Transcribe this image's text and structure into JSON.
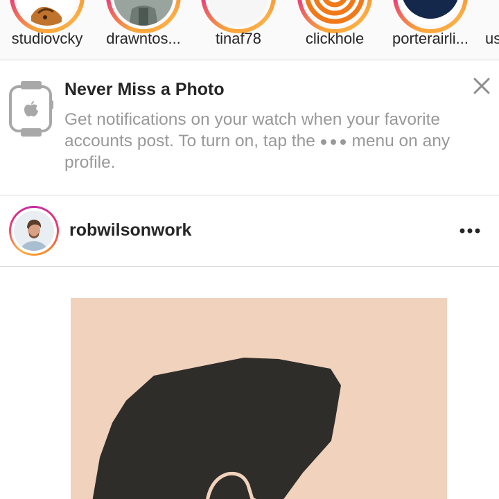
{
  "stories": [
    {
      "username": "studiovcky",
      "avatar": "fox-illustration"
    },
    {
      "username": "drawntos...",
      "avatar": "person-photo"
    },
    {
      "username": "tinaf78",
      "avatar": "white-photo"
    },
    {
      "username": "clickhole",
      "avatar": "clickhole-logo"
    },
    {
      "username": "porterairli...",
      "avatar": "porter-logo"
    },
    {
      "username": "us",
      "avatar": "partial-story"
    }
  ],
  "notification": {
    "title": "Never Miss a Photo",
    "body": "Get notifications on your watch when your favorite accounts post. To turn on, tap the",
    "body_icon": "more-dots-icon",
    "body_end": "menu on any profile.",
    "icon": "apple-watch-icon",
    "close_icon": "close-icon"
  },
  "post": {
    "username": "robwilsonwork",
    "avatar": "user-avatar",
    "menu_icon": "more-options-icon",
    "image": "artwork-dark-shape-on-beige-paper"
  },
  "colors": {
    "text": "#262626",
    "muted": "#999999",
    "divider": "#dbdbdb",
    "story_gradient": [
      "#f9a43a",
      "#e8357c",
      "#c32aa3"
    ],
    "paper": "#f0d2bd",
    "ink": "#2f2d29"
  }
}
